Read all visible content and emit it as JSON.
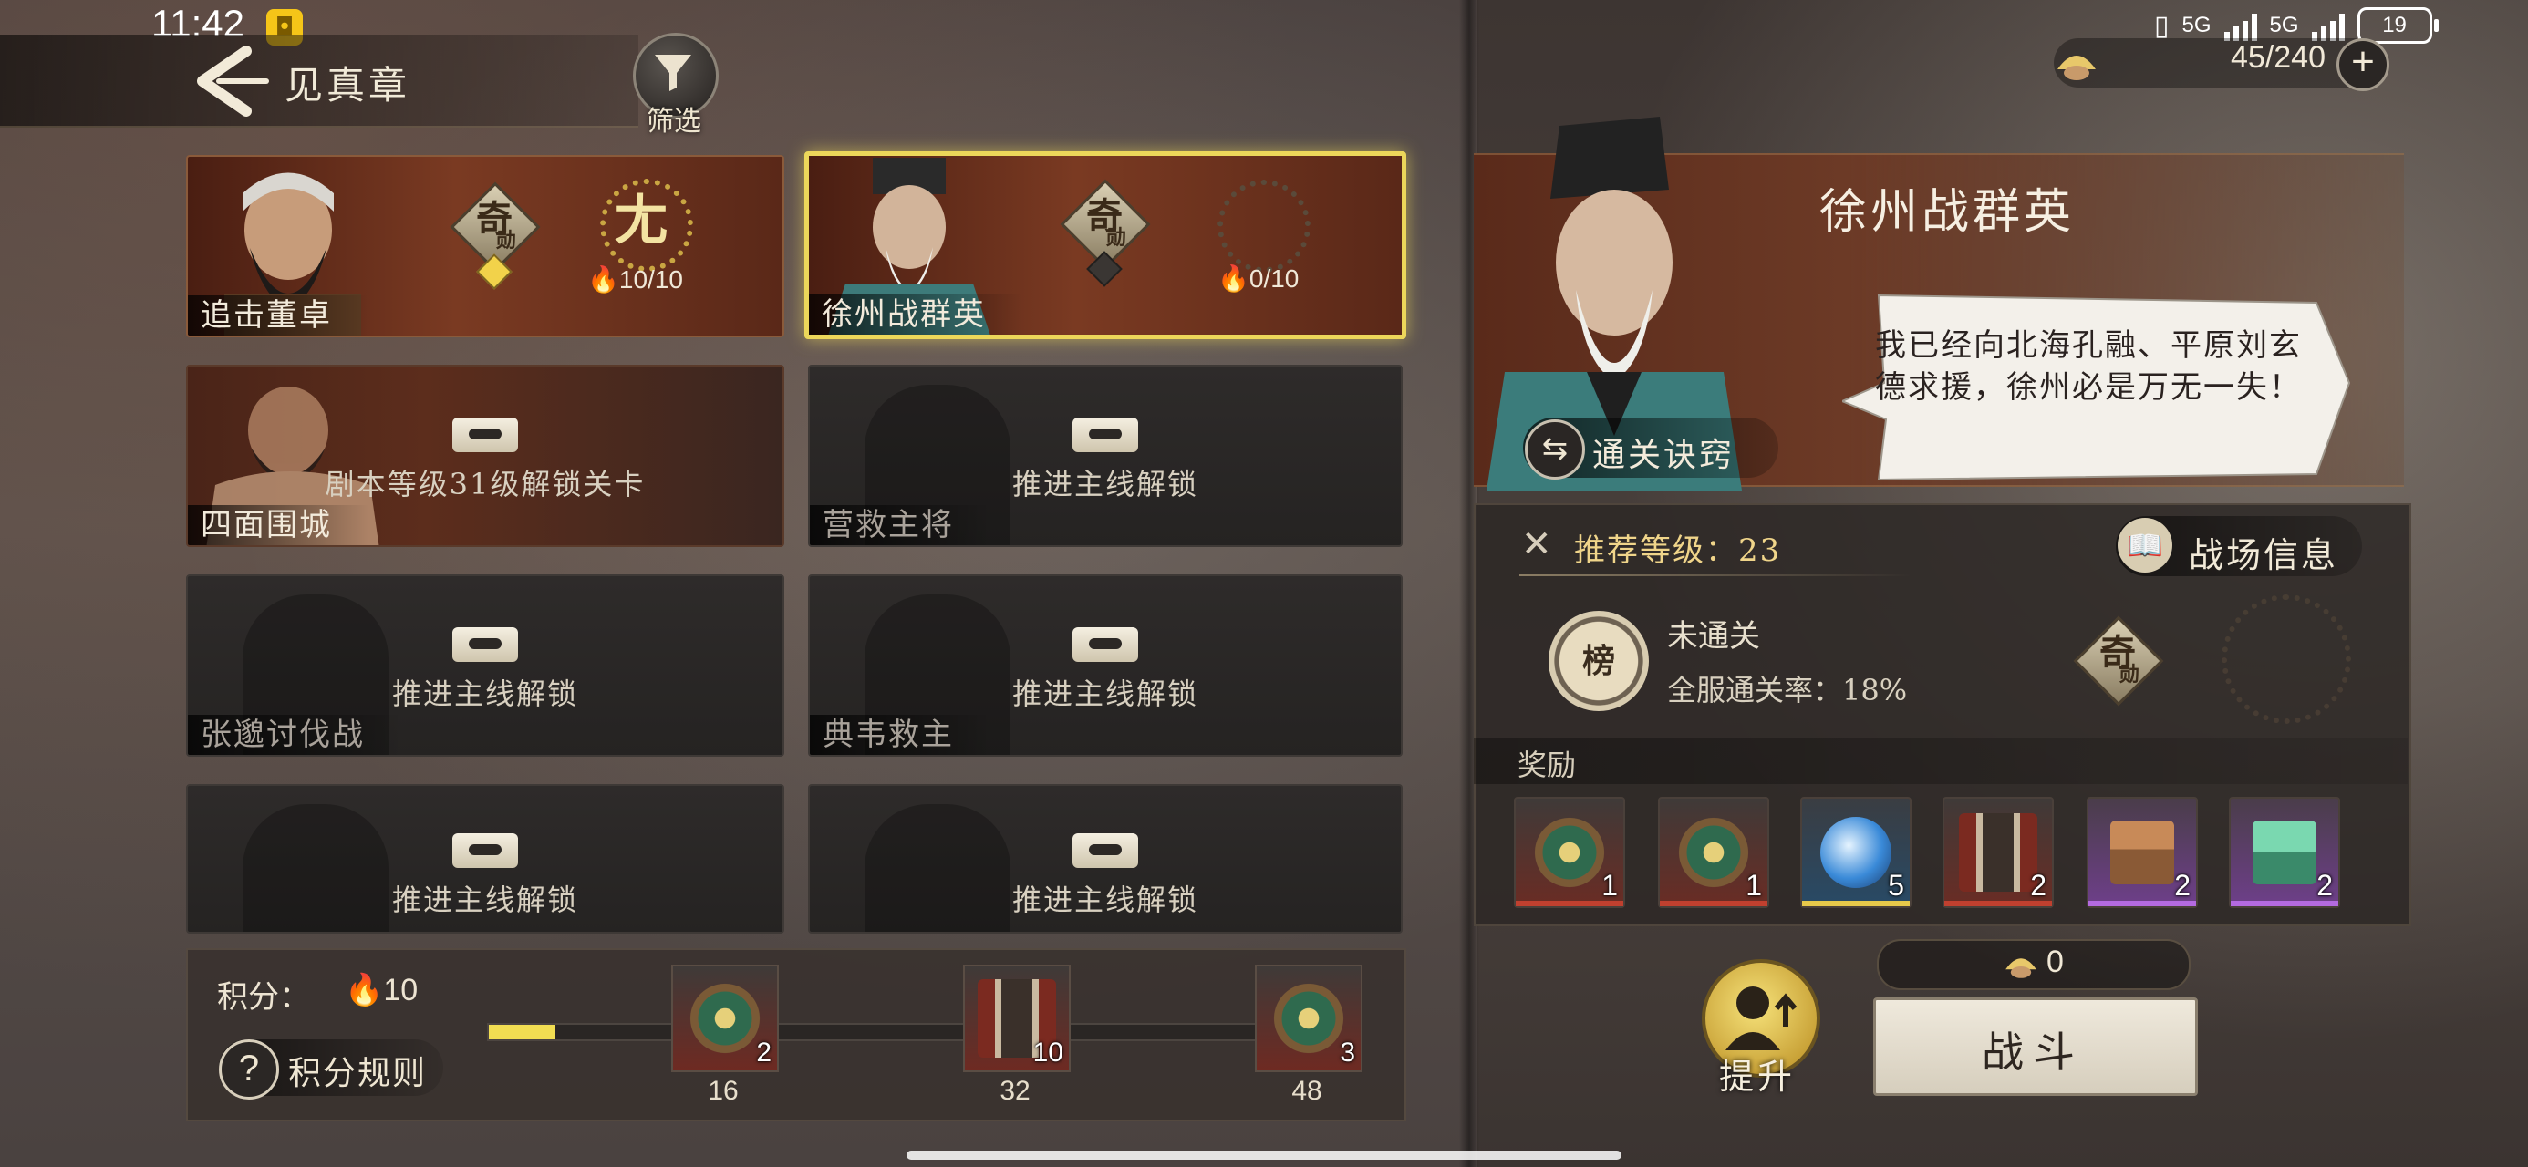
{
  "status_bar": {
    "time": "11:42",
    "net1": "5G",
    "net2": "5G",
    "battery": "19"
  },
  "header": {
    "title": "见真章",
    "filter_label": "筛选"
  },
  "resource": {
    "value": "45/240"
  },
  "stages": [
    {
      "name": "追击董卓",
      "status": "cleared",
      "progress": "10/10",
      "qi": "奇",
      "qi_sub": "勋",
      "medal_char": "尢"
    },
    {
      "name": "徐州战群英",
      "status": "selected",
      "progress": "0/10",
      "qi": "奇",
      "qi_sub": "勋"
    },
    {
      "name": "四面围城",
      "status": "locked",
      "lock_text": "剧本等级31级解锁关卡"
    },
    {
      "name": "营救主将",
      "status": "locked",
      "lock_text": "推进主线解锁"
    },
    {
      "name": "张邈讨伐战",
      "status": "locked",
      "lock_text": "推进主线解锁"
    },
    {
      "name": "典韦救主",
      "status": "locked",
      "lock_text": "推进主线解锁"
    },
    {
      "name": "",
      "status": "locked",
      "lock_text": "推进主线解锁"
    },
    {
      "name": "",
      "status": "locked",
      "lock_text": "推进主线解锁"
    }
  ],
  "score": {
    "label": "积分：",
    "value": "10",
    "rules_label": "积分规则",
    "progress_fraction": 0.078,
    "milestones": [
      {
        "threshold": "16",
        "count": "2",
        "icon": "jade-disc-icon"
      },
      {
        "threshold": "32",
        "count": "10",
        "icon": "banner-chest-icon"
      },
      {
        "threshold": "48",
        "count": "3",
        "icon": "jade-disc-icon"
      }
    ]
  },
  "detail": {
    "title": "徐州战群英",
    "quote": "我已经向北海孔融、平原刘玄德求援，徐州必是万无一失！",
    "tips_label": "通关诀窍",
    "recommended_level": "推荐等级：23",
    "battlefield_label": "战场信息",
    "rank_char": "榜",
    "clear_status": "未通关",
    "clear_rate": "全服通关率：18%",
    "qi": "奇",
    "qi_sub": "勋",
    "rewards_title": "奖励",
    "rewards": [
      {
        "icon": "red-jade-disc-icon",
        "count": "1",
        "rarity": "red"
      },
      {
        "icon": "jade-disc-icon",
        "count": "1",
        "rarity": "red"
      },
      {
        "icon": "blue-orb-icon",
        "count": "5",
        "rarity": "gold"
      },
      {
        "icon": "banner-chest-icon",
        "count": "2",
        "rarity": "red"
      },
      {
        "icon": "bronze-seal-icon",
        "count": "2",
        "rarity": "purple"
      },
      {
        "icon": "jade-seal-icon",
        "count": "2",
        "rarity": "purple"
      }
    ]
  },
  "actions": {
    "upgrade_label": "提升",
    "cost": "0",
    "fight_label": "战斗"
  },
  "colors": {
    "accent": "#ecd75a",
    "progress": "#f2de52",
    "flame": "#ff8a2a"
  }
}
